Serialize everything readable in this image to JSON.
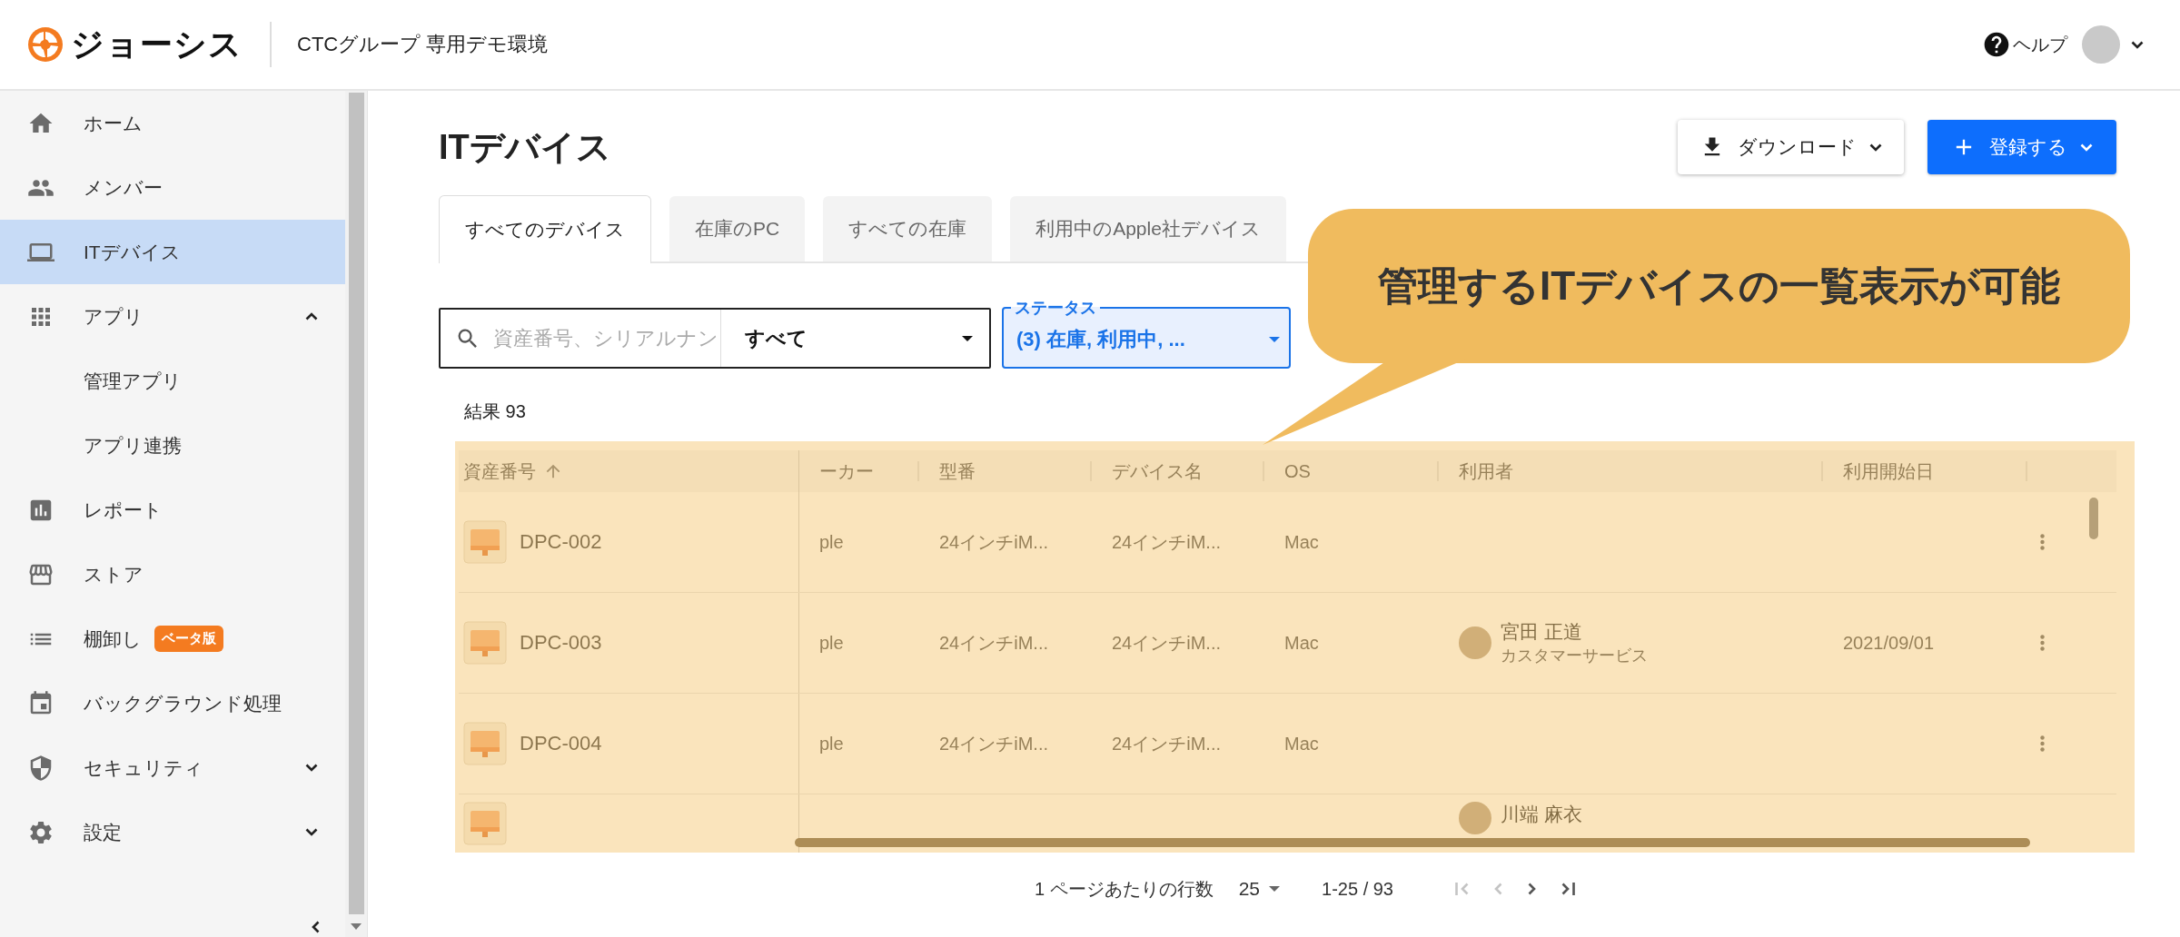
{
  "header": {
    "logo": "ジョーシス",
    "subtitle": "CTCグループ 専用デモ環境",
    "help": "ヘルプ"
  },
  "sidebar": {
    "items": [
      {
        "label": "ホーム",
        "selected": false
      },
      {
        "label": "メンバー",
        "selected": false
      },
      {
        "label": "ITデバイス",
        "selected": true
      },
      {
        "label": "アプリ",
        "selected": false,
        "expanded": true,
        "children": [
          {
            "label": "管理アプリ",
            "selected": false
          },
          {
            "label": "アプリ連携",
            "selected": false
          }
        ]
      },
      {
        "label": "レポート",
        "selected": false
      },
      {
        "label": "ストア",
        "selected": false
      },
      {
        "label": "棚卸し",
        "selected": false,
        "badge": "ベータ版"
      },
      {
        "label": "バックグラウンド処理",
        "selected": false
      },
      {
        "label": "セキュリティ",
        "selected": false,
        "expanded": false
      },
      {
        "label": "設定",
        "selected": false,
        "expanded": false
      }
    ]
  },
  "page": {
    "title": "ITデバイス",
    "download": "ダウンロード",
    "register": "登録する"
  },
  "tabs": [
    {
      "label": "すべてのデバイス",
      "selected": true
    },
    {
      "label": "在庫のPC",
      "selected": false
    },
    {
      "label": "すべての在庫",
      "selected": false
    },
    {
      "label": "利用中のApple社デバイス",
      "selected": false
    }
  ],
  "filters": {
    "search": {
      "placeholder": "資産番号、シリアルナン"
    },
    "scope": "すべて",
    "status": {
      "label": "ステータス",
      "value": "(3) 在庫, 利用中, ..."
    }
  },
  "results": "結果 93",
  "table": {
    "columns": [
      {
        "label": "資産番号",
        "sorted": true
      },
      {
        "label": "ーカー",
        "sorted": false
      },
      {
        "label": "型番",
        "sorted": false
      },
      {
        "label": "デバイス名",
        "sorted": false
      },
      {
        "label": "OS",
        "sorted": false
      },
      {
        "label": "利用者",
        "sorted": false
      },
      {
        "label": "利用開始日",
        "sorted": false
      }
    ],
    "rows": [
      {
        "asset": "DPC-002",
        "maker": "ple",
        "model": "24インチiM...",
        "name": "24インチiM...",
        "os": "Mac"
      },
      {
        "asset": "DPC-003",
        "maker": "ple",
        "model": "24インチiM...",
        "name": "24インチiM...",
        "os": "Mac",
        "user": "宮田 正道",
        "department": "カスタマーサービス",
        "start_date": "2021/09/01"
      },
      {
        "asset": "DPC-004",
        "maker": "ple",
        "model": "24インチiM...",
        "name": "24インチiM...",
        "os": "Mac"
      },
      {
        "user": "川端 麻衣"
      }
    ]
  },
  "pagination": {
    "rows_per_page_label": "1 ページあたりの行数",
    "rows_per_page": "25",
    "range": "1-25 / 93",
    "nav": [
      {
        "kind": "first",
        "disabled": true
      },
      {
        "kind": "prev",
        "disabled": true
      },
      {
        "kind": "next",
        "disabled": false
      },
      {
        "kind": "last",
        "disabled": false
      }
    ]
  },
  "callout": "管理するITデバイスの一覧表示が可能"
}
